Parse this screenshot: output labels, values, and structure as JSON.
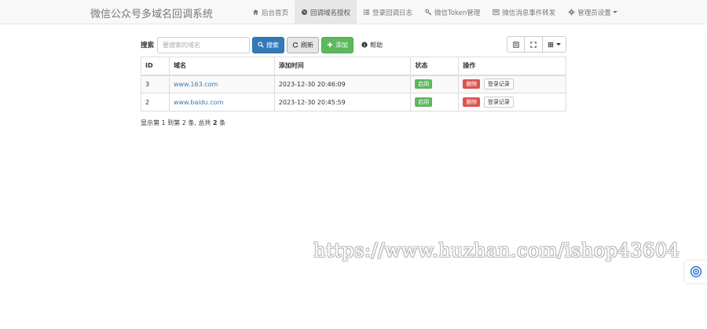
{
  "navbar": {
    "brand": "微信公众号多域名回调系统",
    "items": [
      {
        "label": "后台首页",
        "icon": "home-icon"
      },
      {
        "label": "回调域名授权",
        "icon": "globe-icon",
        "active": true
      },
      {
        "label": "登录回调日志",
        "icon": "list-icon"
      },
      {
        "label": "微信Token管理",
        "icon": "key-icon"
      },
      {
        "label": "微信消息事件转发",
        "icon": "list-alt-icon"
      },
      {
        "label": "管理员设置",
        "icon": "gear-icon",
        "dropdown": true
      }
    ]
  },
  "toolbar": {
    "search_label": "搜索",
    "search_placeholder": "要搜索的域名",
    "search_button": "搜索",
    "refresh_button": "刷新",
    "add_button": "添加",
    "help_button": "帮助"
  },
  "table": {
    "headers": [
      "ID",
      "域名",
      "添加时间",
      "状态",
      "操作"
    ],
    "rows": [
      {
        "id": "3",
        "domain": "www.163.com",
        "time": "2023-12-30 20:46:09",
        "status": "启用",
        "delete": "删除",
        "log": "登录记录"
      },
      {
        "id": "2",
        "domain": "www.baidu.com",
        "time": "2023-12-30 20:45:59",
        "status": "启用",
        "delete": "删除",
        "log": "登录记录"
      }
    ]
  },
  "pagination": {
    "prefix": "显示第 1 到第 2 条, 总共 ",
    "total": "2",
    "suffix": " 条"
  },
  "watermark": "https://www.huzhan.com/ishop43604",
  "colors": {
    "primary": "#337ab7",
    "success": "#5cb85c",
    "danger": "#d9534f",
    "navbar_bg": "#f8f8f8"
  }
}
